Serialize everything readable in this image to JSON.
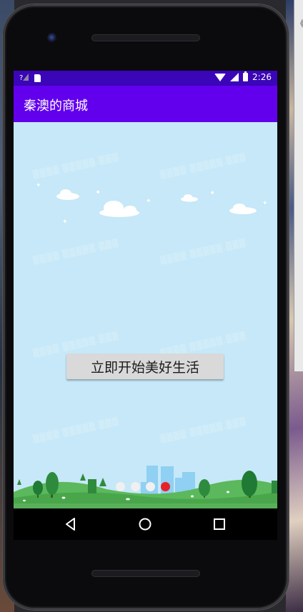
{
  "status_bar": {
    "time": "2:26",
    "signal_label": "?",
    "icons": [
      "signal-unknown-icon",
      "sd-card-icon",
      "wifi-icon",
      "cell-signal-icon",
      "battery-icon"
    ]
  },
  "app_bar": {
    "title": "秦澳的商城",
    "color": "#6200ee",
    "status_color": "#3b05b8"
  },
  "main": {
    "start_button_label": "立即开始美好生活",
    "background_color": "#c6e8f8",
    "page_indicator": {
      "count": 4,
      "active_index": 3,
      "active_color": "#e8202a",
      "inactive_color": "#f0f0f0"
    }
  },
  "nav_bar": {
    "buttons": [
      "back-icon",
      "home-icon",
      "recents-icon"
    ]
  },
  "desktop": {
    "side_glyph": "《"
  }
}
